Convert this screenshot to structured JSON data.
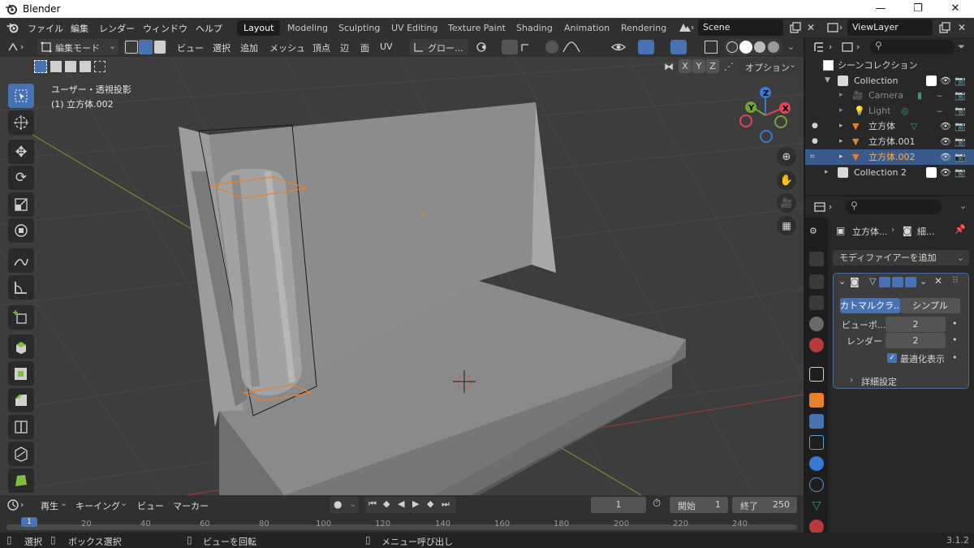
{
  "window": {
    "title": "Blender",
    "minimize_glyph": "—",
    "maximize_glyph": "❐",
    "close_glyph": "✕"
  },
  "menu": {
    "items": [
      "ファイル",
      "編集",
      "レンダー",
      "ウィンドウ",
      "ヘルプ"
    ]
  },
  "workspaces": {
    "tabs": [
      "Layout",
      "Modeling",
      "Sculpting",
      "UV Editing",
      "Texture Paint",
      "Shading",
      "Animation",
      "Rendering"
    ],
    "active": "Layout"
  },
  "scene": {
    "name": "Scene",
    "view_layer": "ViewLayer"
  },
  "viewport_header": {
    "mode": "編集モード",
    "menus": [
      "ビュー",
      "選択",
      "追加",
      "メッシュ",
      "頂点",
      "辺",
      "面",
      "UV"
    ],
    "transform_orientation": "グロー...",
    "axes": [
      "X",
      "Y",
      "Z"
    ],
    "options_label": "オプション"
  },
  "viewport": {
    "view_name": "ユーザー・透視投影",
    "object_info": "(1) 立方体.002",
    "gizmo_axes": [
      "Z",
      "Y",
      "X"
    ],
    "colors": {
      "background": "#3d3d3d",
      "grid": "#4a4a4a",
      "x_axis": "#8c3a3a",
      "y_axis": "#6e8c2a",
      "selection": "#e8822a",
      "gizmo_x": "#e04653",
      "gizmo_y": "#72a532",
      "gizmo_z": "#3a7ad6"
    }
  },
  "tools": [
    "select-box",
    "cursor",
    "move",
    "rotate",
    "scale",
    "transform",
    "annotate",
    "measure",
    "add-cube",
    "extrude",
    "inset",
    "bevel",
    "loop-cut",
    "knife",
    "poly-build"
  ],
  "outliner": {
    "title": "シーンコレクション",
    "rows": [
      {
        "label": "Collection",
        "indent": 1,
        "type": "collection"
      },
      {
        "label": "Camera",
        "indent": 2,
        "type": "camera",
        "dim": true
      },
      {
        "label": "Light",
        "indent": 2,
        "type": "light",
        "dim": true
      },
      {
        "label": "立方体",
        "indent": 2,
        "type": "mesh"
      },
      {
        "label": "立方体.001",
        "indent": 2,
        "type": "mesh"
      },
      {
        "label": "立方体.002",
        "indent": 2,
        "type": "mesh",
        "selected": true
      },
      {
        "label": "Collection 2",
        "indent": 1,
        "type": "collection"
      }
    ]
  },
  "properties": {
    "breadcrumb_object": "立方体...",
    "breadcrumb_modifier": "細...",
    "add_modifier_label": "モディファイアーを追加",
    "subdivision": {
      "type_options": [
        "カトマルクラ...",
        "シンプル"
      ],
      "selected_type": "カトマルクラ...",
      "viewport_label": "ビューポ...",
      "viewport_value": "2",
      "render_label": "レンダー",
      "render_value": "2",
      "optimal_display_label": "最適化表示",
      "advanced_label": "詳細設定"
    }
  },
  "timeline": {
    "menus": [
      "再生",
      "キーイング",
      "ビュー",
      "マーカー"
    ],
    "current_frame": "1",
    "start_label": "開始",
    "start_value": "1",
    "end_label": "終了",
    "end_value": "250",
    "ticks": [
      "1",
      "20",
      "40",
      "60",
      "80",
      "100",
      "120",
      "140",
      "160",
      "180",
      "200",
      "220",
      "240"
    ]
  },
  "statusbar": {
    "items": [
      "選択",
      "ボックス選択",
      "ビューを回転",
      "メニュー呼び出し"
    ],
    "version": "3.1.2"
  }
}
